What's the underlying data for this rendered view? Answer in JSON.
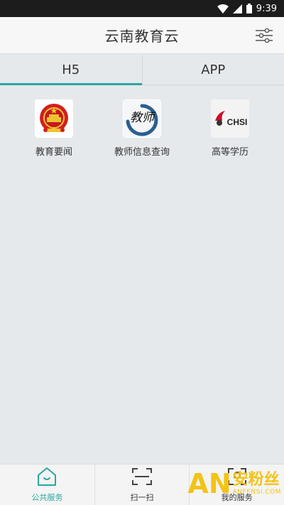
{
  "status_bar": {
    "time": "9:39"
  },
  "header": {
    "title": "云南教育云",
    "filter_icon": "filter-sliders-icon"
  },
  "tabs": [
    {
      "label": "H5",
      "active": true
    },
    {
      "label": "APP",
      "active": false
    }
  ],
  "apps": [
    {
      "label": "教育要闻",
      "icon": "national-emblem-icon"
    },
    {
      "label": "教师信息查询",
      "icon": "teacher-calligraphy-icon",
      "icon_text": "教师"
    },
    {
      "label": "高等学历",
      "icon": "chsi-logo-icon",
      "icon_text": "CHSI"
    }
  ],
  "bottom_nav": [
    {
      "label": "公共服务",
      "icon": "home-icon",
      "active": true
    },
    {
      "label": "扫一扫",
      "icon": "scan-icon",
      "active": false
    },
    {
      "label": "我的服务",
      "icon": "my-service-icon",
      "active": false
    }
  ],
  "watermark": {
    "text": "安粉丝",
    "url": "ANFENSI.COM"
  },
  "colors": {
    "accent": "#2aa7a0",
    "background": "#e6e9ec",
    "header": "#f7f7f7"
  }
}
